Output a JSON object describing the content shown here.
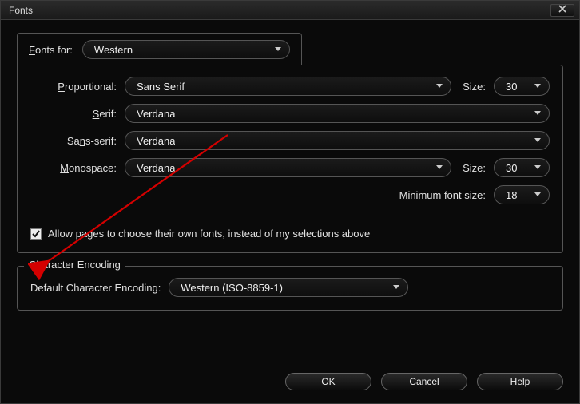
{
  "window": {
    "title": "Fonts"
  },
  "fonts_for": {
    "label_pre": "F",
    "label_post": "onts for:",
    "value": "Western"
  },
  "rows": {
    "proportional": {
      "label_pre": "P",
      "label_post": "roportional:",
      "value": "Sans Serif",
      "size_label": "Size:",
      "size_value": "30"
    },
    "serif": {
      "label_pre": "S",
      "label_post": "erif:",
      "value": "Verdana"
    },
    "sans_serif": {
      "label_pre": "Sa",
      "label_mid": "n",
      "label_post": "s-serif:",
      "value": "Verdana"
    },
    "monospace": {
      "label_pre": "M",
      "label_post": "onospace:",
      "value": "Verdana",
      "size_label": "Size:",
      "size_value": "30"
    },
    "min_size": {
      "label_pre": "Minimum fo",
      "label_mid": "n",
      "label_post": "t size:",
      "value": "18"
    }
  },
  "allow_checkbox": {
    "checked": true,
    "label_pre": "A",
    "label_post": "llow pages to choose their own fonts, instead of my selections above"
  },
  "encoding": {
    "legend": "Character Encoding",
    "label": "Default Character Encoding:",
    "value": "Western (ISO-8859-1)"
  },
  "buttons": {
    "ok": "OK",
    "cancel": "Cancel",
    "help_pre": "H",
    "help_post": "elp"
  }
}
